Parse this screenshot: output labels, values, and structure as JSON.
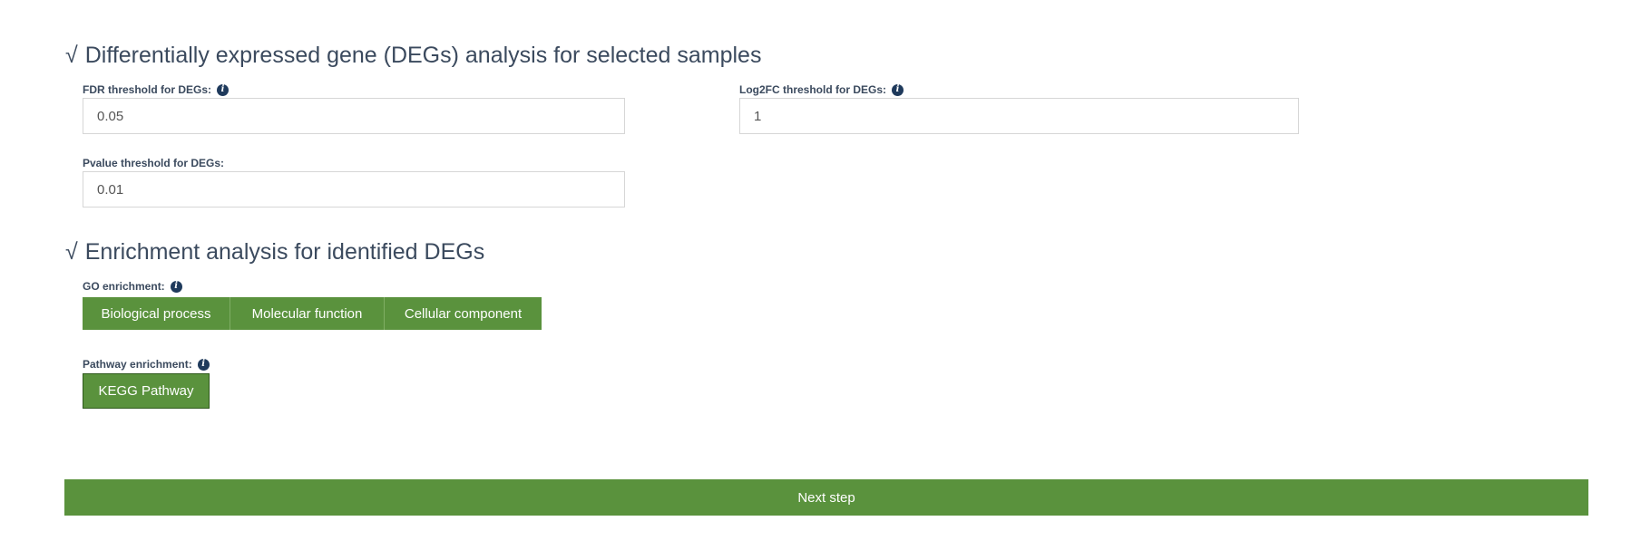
{
  "deg_section": {
    "check": "√",
    "title": "Differentially expressed gene (DEGs) analysis for selected samples",
    "fdr": {
      "label": "FDR threshold for DEGs:",
      "value": "0.05"
    },
    "log2fc": {
      "label": "Log2FC threshold for DEGs:",
      "value": "1"
    },
    "pvalue": {
      "label": "Pvalue threshold for DEGs:",
      "value": "0.01"
    }
  },
  "enrichment_section": {
    "check": "√",
    "title": "Enrichment analysis for identified DEGs",
    "go": {
      "label": "GO enrichment:",
      "buttons": [
        "Biological process",
        "Molecular function",
        "Cellular component"
      ]
    },
    "pathway": {
      "label": "Pathway enrichment:",
      "buttons": [
        "KEGG Pathway"
      ]
    }
  },
  "info_icon_glyph": "i",
  "next_button_label": "Next step",
  "colors": {
    "accent_green": "#5a923d",
    "heading_text": "#3b4a5e",
    "info_icon_bg": "#1f3a5c"
  }
}
